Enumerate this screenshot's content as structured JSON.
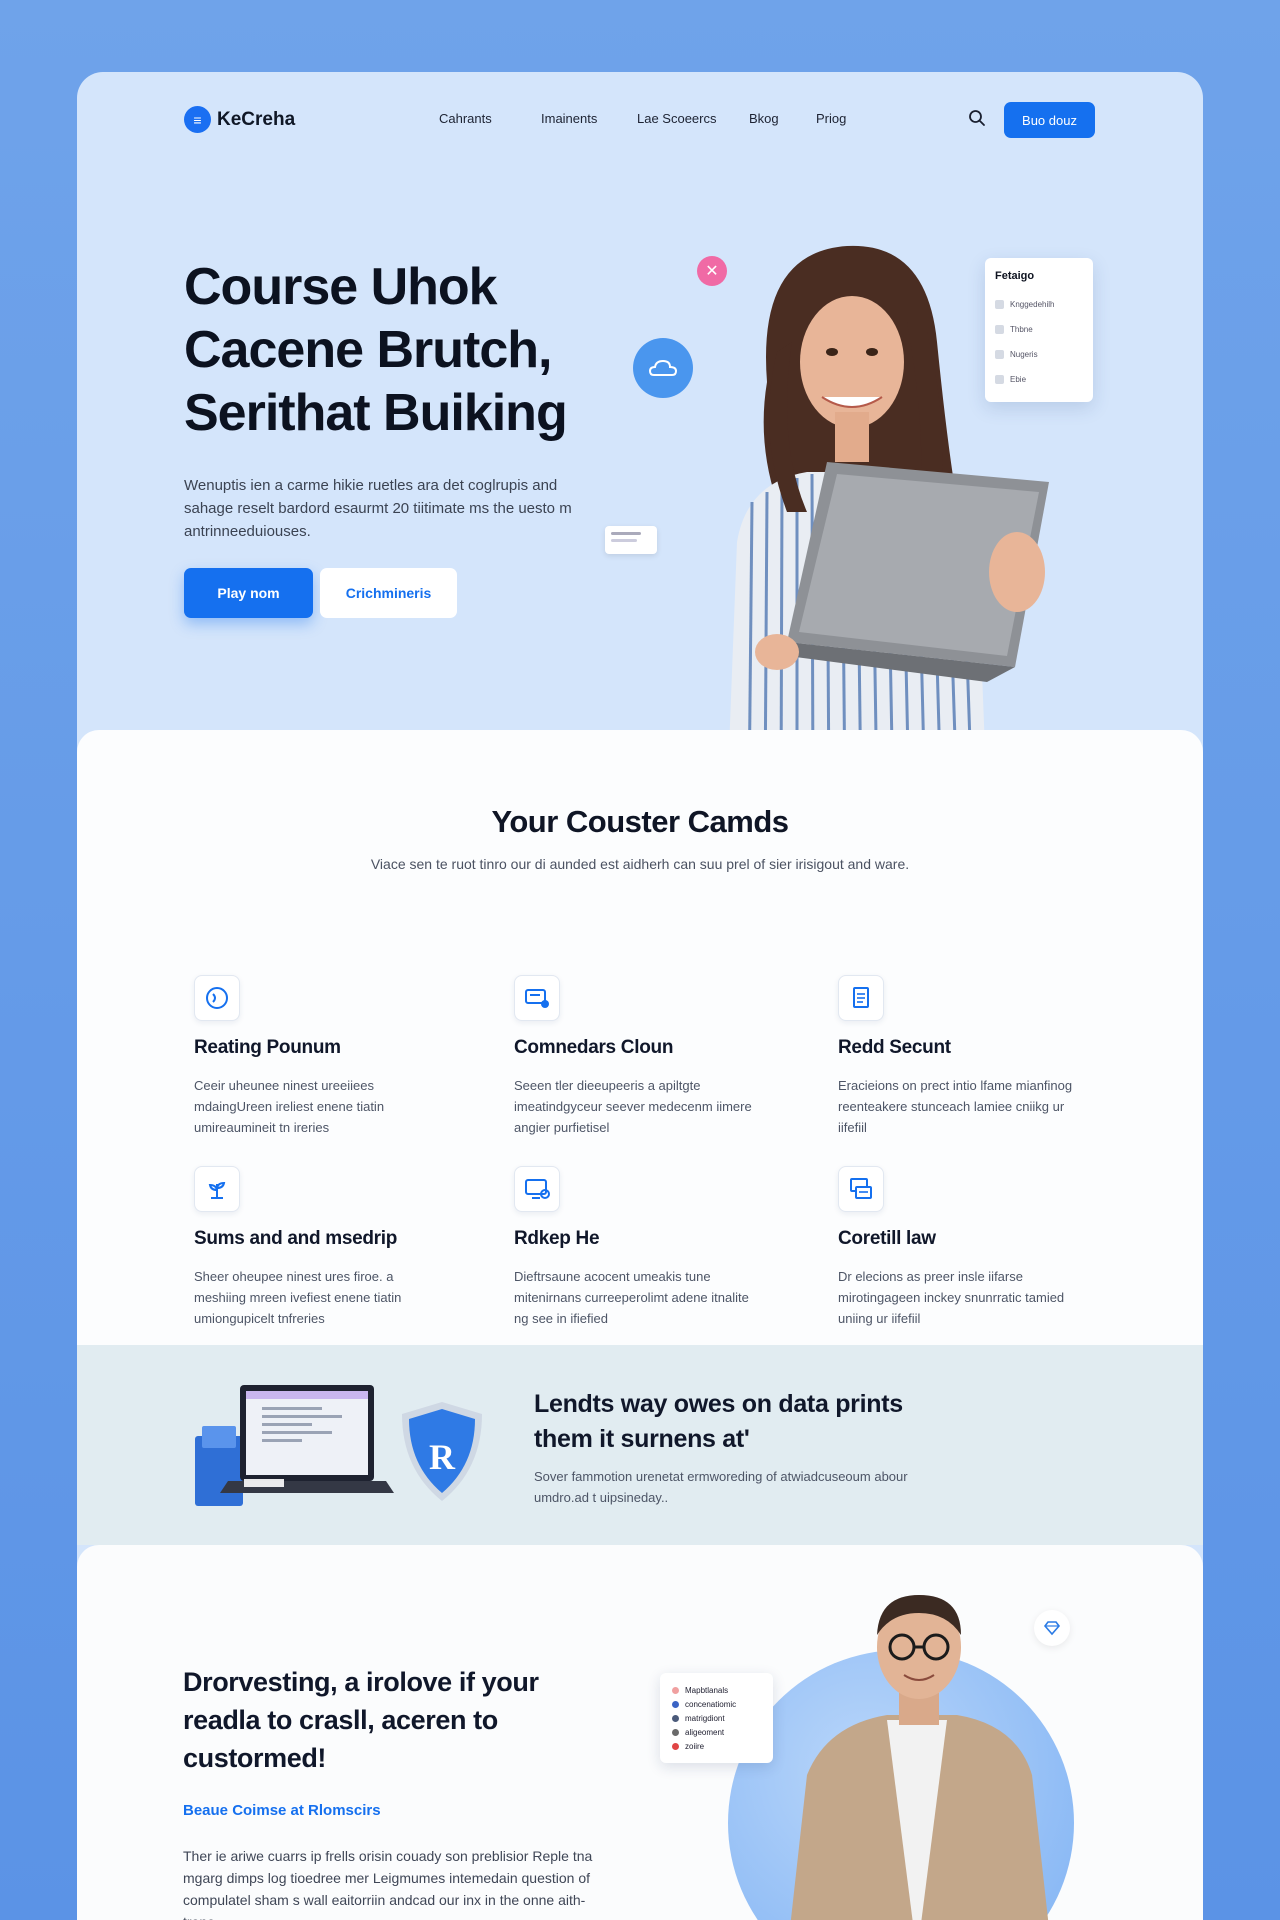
{
  "brand": {
    "name": "KeCreha"
  },
  "nav": {
    "links": [
      "Cahrants",
      "Imainents",
      "Lae Scoeercs",
      "Bkog",
      "Priog"
    ],
    "cta_label": "Buo douz"
  },
  "hero": {
    "title_lines": [
      "Course Uhok",
      "Cacene Brutch,",
      "Serithat Buiking"
    ],
    "description": "Wenuptis ien a carme hikie ruetles ara det coglrupis and sahage reselt bardord esaurmt 20 tiitimate ms the uesto m antrinneeduiouses.",
    "primary_button": "Play nom",
    "secondary_button": "Crichmineris",
    "menu_card": {
      "title": "Fetaigo",
      "items": [
        "Knggedehilh",
        "Thbne",
        "Nugeris",
        "Ebie"
      ]
    }
  },
  "features": {
    "title": "Your Couster Camds",
    "subtitle": "Viace sen te ruot tinro our di aunded est aidherh can suu prel of sier irisigout and ware.",
    "items": [
      {
        "icon": "globe-icon",
        "title": "Reating Pounum",
        "text": "Ceeir uheunee ninest ureeiiees mdaingUreen ireliest enene tiatin umireaumineit tn ireries"
      },
      {
        "icon": "chat-icon",
        "title": "Comnedars Cloun",
        "text": "Seeen tler dieeupeeris a apiltgte imeatindgyceur seever medecenm iimere angier purfietisel"
      },
      {
        "icon": "document-icon",
        "title": "Redd Secunt",
        "text": "Eracieions on prect intio lfame mianfinog reenteakere stunceach lamiee cniikg ur iifefiil"
      },
      {
        "icon": "plant-icon",
        "title": "Sums and and msedrip",
        "text": "Sheer oheupee ninest ures firoe. a meshiing mreen ivefiest enene tiatin umiongupicelt tnfreries"
      },
      {
        "icon": "monitor-icon",
        "title": "Rdkep He",
        "text": "Dieftrsaune acocent umeakis tune mitenirnans curreeperolimt adene itnalite ng see in ifiefied"
      },
      {
        "icon": "screens-icon",
        "title": "Coretill law",
        "text": "Dr elecions as preer insle iifarse mirotingageen inckey snunrratic tamied uniing ur iifefiil"
      }
    ]
  },
  "band": {
    "title": "Lendts way owes on data prints them it surnens at'",
    "description": "Sover fammotion urenetat ermworeding of atwiadcuseoum abour umdro.ad t uipsineday..",
    "shield_text": "R"
  },
  "bottom": {
    "title": "Drorvesting, a irolove if your readla to crasll, aceren to custormed!",
    "link": "Beaue Coimse at Rlomscirs",
    "description": "Ther ie ariwe cuarrs ip frells orisin couady son preblisior Reple tna mgarg dimps log tioedree mer Leigmumes intemedain question of compulatel sham s wall eaitorriin andcad our inx in the onne aith-trone.",
    "mini_card_items": [
      "Mapbtlanals",
      "concenatiomic",
      "matrigdiont",
      "aligeoment",
      "zoiire"
    ]
  }
}
